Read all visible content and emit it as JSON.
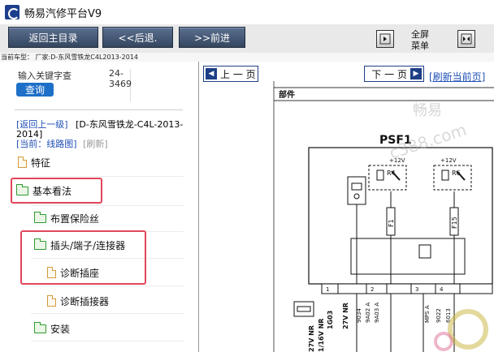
{
  "window": {
    "title": "畅易汽修平台V9"
  },
  "toolbar": {
    "home_label": "返回主目录",
    "back_label": "<<后退.",
    "forward_label": ">>前进",
    "fullscreen_line1": "全屏",
    "fullscreen_line2": "菜单"
  },
  "vehicle": {
    "line": "当前车型： 厂家:D-东风雪铁龙C4L2013-2014"
  },
  "search": {
    "label": "输入关键字查",
    "hint_line1": "24-",
    "hint_line2": "3469",
    "button_label": "查询"
  },
  "breadcrumb": {
    "back_link": "[返回上一级]",
    "vehicle": "[D-东风雪铁龙-C4L-2013-2014]",
    "current": "[当前：线路图]",
    "refresh": "[刷新]"
  },
  "tree": [
    {
      "label": "特征",
      "icon": "document-icon"
    },
    {
      "label": "基本看法",
      "icon": "folder-icon"
    },
    {
      "label": "布置保险丝",
      "icon": "folder-icon"
    },
    {
      "label": "插头/端子/连接器",
      "icon": "folder-icon"
    },
    {
      "label": "诊断插座",
      "icon": "document-icon"
    },
    {
      "label": "诊断插接器",
      "icon": "document-icon"
    },
    {
      "label": "安装",
      "icon": "folder-icon"
    }
  ],
  "viewer": {
    "prev_label": "上 一 页",
    "next_label": "下 一 页",
    "refresh_label": "[刷新当前页]"
  },
  "diagram": {
    "header": "部件",
    "title": "PSF1",
    "voltage_a": "+12V",
    "voltage_b": "+12V",
    "relay_a": "R4",
    "relay_b": "R6",
    "fuse_a": "F1",
    "fuse_b": "F15",
    "pin_a": "1",
    "pin_b": "2",
    "pin_c": "3",
    "pin_d": "4",
    "wire_a": "27V NR",
    "wire_b": "1/16V NR",
    "wire_c": "27V NR",
    "code_a": "9034",
    "code_b": "9A02 A",
    "code_c": "9A03 A",
    "code_d": "MPS A",
    "code_e": "9022",
    "code_f": "6013",
    "code_g": "1G03",
    "watermark_a": "畅易",
    "watermark_b": "c388.com"
  },
  "colors": {
    "accent": "#1f4fb6",
    "highlight": "#e0475a",
    "toolbar_button": "#3c4f6b",
    "nav_blue": "#1d3f86"
  }
}
